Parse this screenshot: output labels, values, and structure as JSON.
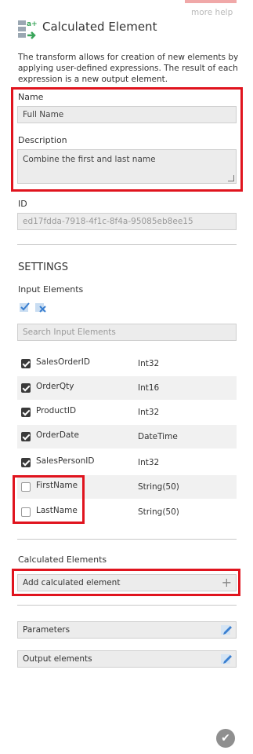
{
  "header": {
    "help_label": "more help",
    "title": "Calculated Element",
    "description": "The transform allows for creation of new elements by applying user-defined expressions. The result of each expression is a new output element."
  },
  "form": {
    "name_label": "Name",
    "name_value": "Full Name",
    "description_label": "Description",
    "description_value": "Combine the first and last name",
    "id_label": "ID",
    "id_value": "ed17fdda-7918-4f1c-8f4a-95085eb8ee15"
  },
  "settings": {
    "title": "SETTINGS",
    "input_elements_label": "Input Elements",
    "search_placeholder": "Search Input Elements",
    "rows": [
      {
        "name": "SalesOrderID",
        "type": "Int32",
        "checked": true
      },
      {
        "name": "OrderQty",
        "type": "Int16",
        "checked": true
      },
      {
        "name": "ProductID",
        "type": "Int32",
        "checked": true
      },
      {
        "name": "OrderDate",
        "type": "DateTime",
        "checked": true
      },
      {
        "name": "SalesPersonID",
        "type": "Int32",
        "checked": true
      },
      {
        "name": "FirstName",
        "type": "String(50)",
        "checked": false
      },
      {
        "name": "LastName",
        "type": "String(50)",
        "checked": false
      }
    ],
    "calculated_label": "Calculated Elements",
    "add_calculated_label": "Add calculated element",
    "parameters_label": "Parameters",
    "output_elements_label": "Output elements"
  },
  "colors": {
    "highlight": "#e0141e",
    "icon_blue": "#3a7fd0",
    "icon_green": "#3aa55a"
  }
}
